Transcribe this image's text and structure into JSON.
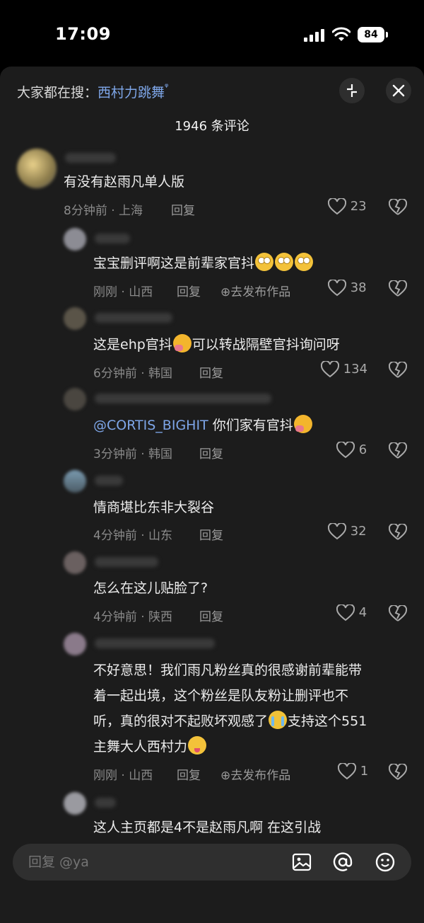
{
  "status_bar": {
    "time": "17:09",
    "battery": "84"
  },
  "header": {
    "search_prefix": "大家都在搜：",
    "search_keyword": "西村力跳舞",
    "search_suffix_icon": "ᵠ",
    "comment_count": "1946 条评论"
  },
  "comments": [
    {
      "text": "有没有赵雨凡单人版",
      "time": "8分钟前 · 上海",
      "reply": "回复",
      "likes": "23"
    },
    {
      "text": "宝宝删评啊这是前辈家官抖",
      "time": "刚刚 · 山西",
      "reply": "回复",
      "publish": "⊕去发布作品",
      "likes": "38"
    },
    {
      "text_a": "这是ehp官抖",
      "text_b": "可以转战隔壁官抖询问呀",
      "time": "6分钟前 · 韩国",
      "reply": "回复",
      "likes": "134"
    },
    {
      "mention": "@CORTIS_BIGHIT",
      "text": " 你们家有官抖",
      "time": "3分钟前 · 韩国",
      "reply": "回复",
      "likes": "6"
    },
    {
      "text": "情商堪比东非大裂谷",
      "time": "4分钟前 · 山东",
      "reply": "回复",
      "likes": "32"
    },
    {
      "text": "怎么在这儿贴脸了?",
      "time": "4分钟前 · 陕西",
      "reply": "回复",
      "likes": "4"
    },
    {
      "line1": "不好意思！我们雨凡粉丝真的很感谢前辈能带",
      "line2": "着一起出境，这个粉丝是队友粉让删评也不",
      "line3": "听，真的很对不起败坏观感了",
      "line3b": "支持这个551",
      "line4": "主舞大人西村力",
      "time": "刚刚 · 山西",
      "reply": "回复",
      "publish": "⊕去发布作品",
      "likes": "1"
    },
    {
      "text": "这人主页都是4不是赵雨凡啊 在这引战"
    }
  ],
  "input": {
    "placeholder": "回复 @ya"
  },
  "icons": {
    "collapse": "collapse-icon",
    "close": "close-icon",
    "like": "heart-icon",
    "dislike": "broken-heart-icon",
    "image": "image-icon",
    "at": "at-icon",
    "emoji": "emoji-icon"
  },
  "colors": {
    "accent": "#7ea6e8",
    "sheet_bg": "#1c1c1c"
  }
}
